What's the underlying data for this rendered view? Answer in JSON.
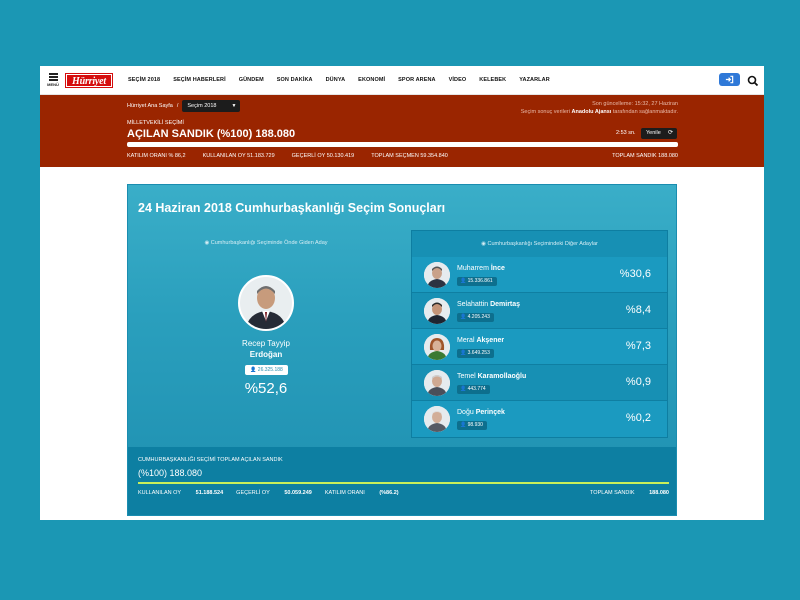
{
  "nav": {
    "menu_label": "MENÜ",
    "logo": "Hürriyet",
    "links": [
      "SEÇİM 2018",
      "SEÇİM HABERLERİ",
      "GÜNDEM",
      "SON DAKİKA",
      "DÜNYA",
      "EKONOMİ",
      "SPOR ARENA",
      "VİDEO",
      "KELEBEK",
      "YAZARLAR"
    ],
    "login_icon": "login-icon",
    "search_icon": "search-icon"
  },
  "header": {
    "breadcrumb_home": "Hürriyet Ana Sayfa",
    "breadcrumb_sep": "/",
    "select_value": "Seçim 2018",
    "updated": "Son güncelleme: 15:32, 27 Haziran",
    "source_pre": "Seçim sonuç verileri",
    "source_name": "Anadolu Ajansı",
    "source_post": "tarafından sağlanmaktadır.",
    "election_label": "MİLLETVEKİLİ SEÇİMİ",
    "title": "AÇILAN SANDIK (%100) 188.080",
    "timer": "2:53 sn.",
    "refresh_label": "Yenile",
    "progress": 1.0,
    "stats": {
      "turnout": "KATILIM ORANI % 86,2",
      "used_votes": "KULLANILAN OY 51.183.729",
      "valid_votes": "GEÇERLİ OY 50.130.419",
      "total_voters": "TOPLAM SEÇMEN 59.354.840",
      "total_boxes": "TOPLAM SANDIK 188.080"
    }
  },
  "panel": {
    "title": "24 Haziran 2018 Cumhurbaşkanlığı Seçim Sonuçları",
    "leader_heading": "Cumhurbaşkanlığı Seçiminde Önde Giden Aday",
    "leader": {
      "first": "Recep Tayyip",
      "last": "Erdoğan",
      "votes": "26.325.188",
      "pct": "%52,6"
    },
    "others_heading": "Cumhurbaşkanlığı Seçimindeki Diğer Adaylar",
    "candidates": [
      {
        "first": "Muharrem ",
        "last": "İnce",
        "votes": "15.336.861",
        "pct": "%30,6"
      },
      {
        "first": "Selahattin ",
        "last": "Demirtaş",
        "votes": "4.205.243",
        "pct": "%8,4"
      },
      {
        "first": "Meral ",
        "last": "Akşener",
        "votes": "3.649.253",
        "pct": "%7,3"
      },
      {
        "first": "Temel ",
        "last": "Karamollaoğlu",
        "votes": "443.774",
        "pct": "%0,9"
      },
      {
        "first": "Doğu ",
        "last": "Perinçek",
        "votes": "98.930",
        "pct": "%0,2"
      }
    ],
    "bottom": {
      "label": "CUMHURBAŞKANLIĞI SEÇİMİ TOPLAM AÇILAN SANDIK",
      "title": "(%100) 188.080",
      "used_votes_label": "KULLANILAN OY",
      "used_votes": "51.188.524",
      "valid_votes_label": "GEÇERLİ OY",
      "valid_votes": "50.059.249",
      "turnout_label": "KATILIM ORANI",
      "turnout": "(%86.2)",
      "total_boxes_label": "TOPLAM SANDIK",
      "total_boxes": "188.080"
    }
  },
  "colors": {
    "background": "#1b97b4",
    "red_bar": "#9a2500",
    "panel": "#2a9fbd",
    "accent_line": "#c8ef5a",
    "logo_red": "#d50d0d"
  }
}
